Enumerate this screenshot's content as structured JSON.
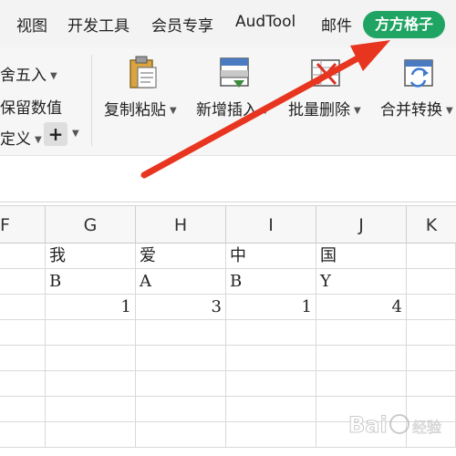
{
  "tabs": [
    {
      "label": "视图"
    },
    {
      "label": "开发工具"
    },
    {
      "label": "会员专享"
    },
    {
      "label": "AudTool"
    },
    {
      "label": "邮件"
    },
    {
      "label": "方方格子"
    }
  ],
  "ribbon": {
    "left_items": [
      {
        "label": "舍五入"
      },
      {
        "label": "保留数值"
      },
      {
        "label": "定义"
      }
    ],
    "buttons": [
      {
        "label": "复制粘贴",
        "icon": "clipboard-paste-icon"
      },
      {
        "label": "新增插入",
        "icon": "insert-rows-icon"
      },
      {
        "label": "批量删除",
        "icon": "batch-delete-icon"
      },
      {
        "label": "合并转换",
        "icon": "merge-convert-icon"
      }
    ]
  },
  "columns": [
    "F",
    "G",
    "H",
    "I",
    "J",
    "K"
  ],
  "rows": [
    [
      "",
      "我",
      "爱",
      "中",
      "国",
      ""
    ],
    [
      "",
      "B",
      "A",
      "B",
      "Y",
      ""
    ],
    [
      "",
      "1",
      "3",
      "1",
      "4",
      ""
    ]
  ],
  "colors": {
    "accent": "#1fa463",
    "arrow": "#e8351f"
  },
  "watermark": "Baidu经验"
}
